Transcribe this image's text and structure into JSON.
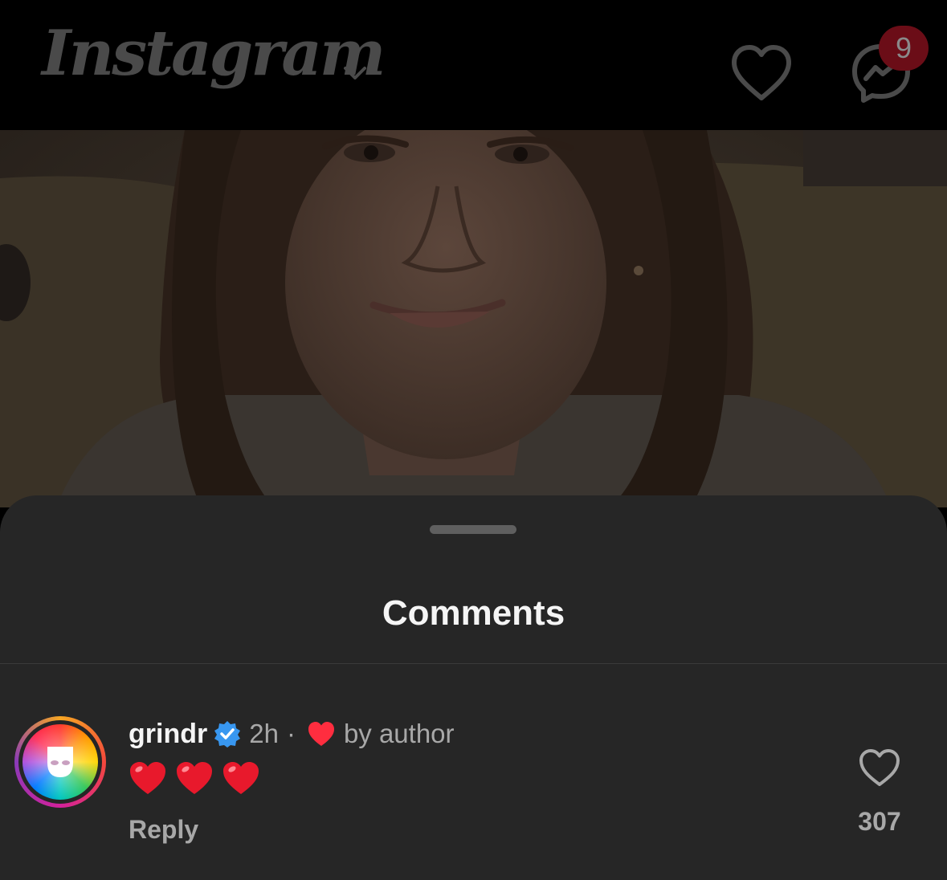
{
  "header": {
    "logo_text": "Instagram",
    "logo_menu_icon": "chevron-down-icon",
    "notifications_icon": "heart-outline-icon",
    "messages_icon": "messenger-icon",
    "messages_badge": "9"
  },
  "post": {
    "image": "dimmed portrait photo of a smiling woman with long brown hair"
  },
  "comments_sheet": {
    "title": "Comments",
    "comments": [
      {
        "username": "grindr",
        "verified": true,
        "time": "2h",
        "separator": "·",
        "liked_by_author_label": "by author",
        "text": "❤️❤️❤️",
        "reply_label": "Reply",
        "like_count": "307"
      }
    ]
  },
  "colors": {
    "sheet_background": "#262626",
    "header_background": "#000000",
    "badge_background": "#6b0d17",
    "verified_blue": "#3897f0",
    "heart_red": "#ff2d3f",
    "secondary_text": "#a8a8a8"
  }
}
